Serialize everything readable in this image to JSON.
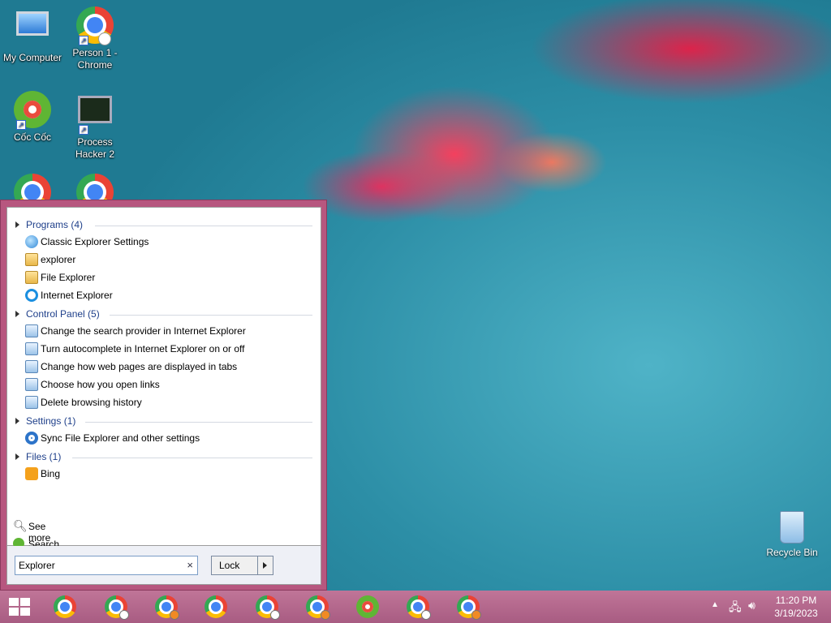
{
  "desktop": {
    "icons": [
      {
        "label": "My Computer"
      },
      {
        "label": "Person 1 -\nChrome"
      },
      {
        "label": "Cốc Cốc"
      },
      {
        "label": "Process\nHacker 2"
      }
    ],
    "recycle_bin": "Recycle Bin"
  },
  "start_menu": {
    "groups": [
      {
        "header": "Programs (4)",
        "items": [
          "Classic Explorer Settings",
          "explorer",
          "File Explorer",
          "Internet Explorer"
        ]
      },
      {
        "header": "Control Panel (5)",
        "items": [
          "Change the search provider in Internet Explorer",
          "Turn autocomplete in Internet Explorer on or off",
          "Change how web pages are displayed in tabs",
          "Choose how you open links",
          "Delete browsing history"
        ]
      },
      {
        "header": "Settings (1)",
        "items": [
          "Sync File Explorer and other settings"
        ]
      },
      {
        "header": "Files (1)",
        "items": [
          "Bing"
        ]
      }
    ],
    "see_more": "See more results",
    "search_internet": "Search the Internet",
    "search_value": "Explorer",
    "clear_glyph": "×",
    "lock_label": "Lock"
  },
  "taskbar": {
    "clock_time": "11:20 PM",
    "clock_date": "3/19/2023"
  }
}
